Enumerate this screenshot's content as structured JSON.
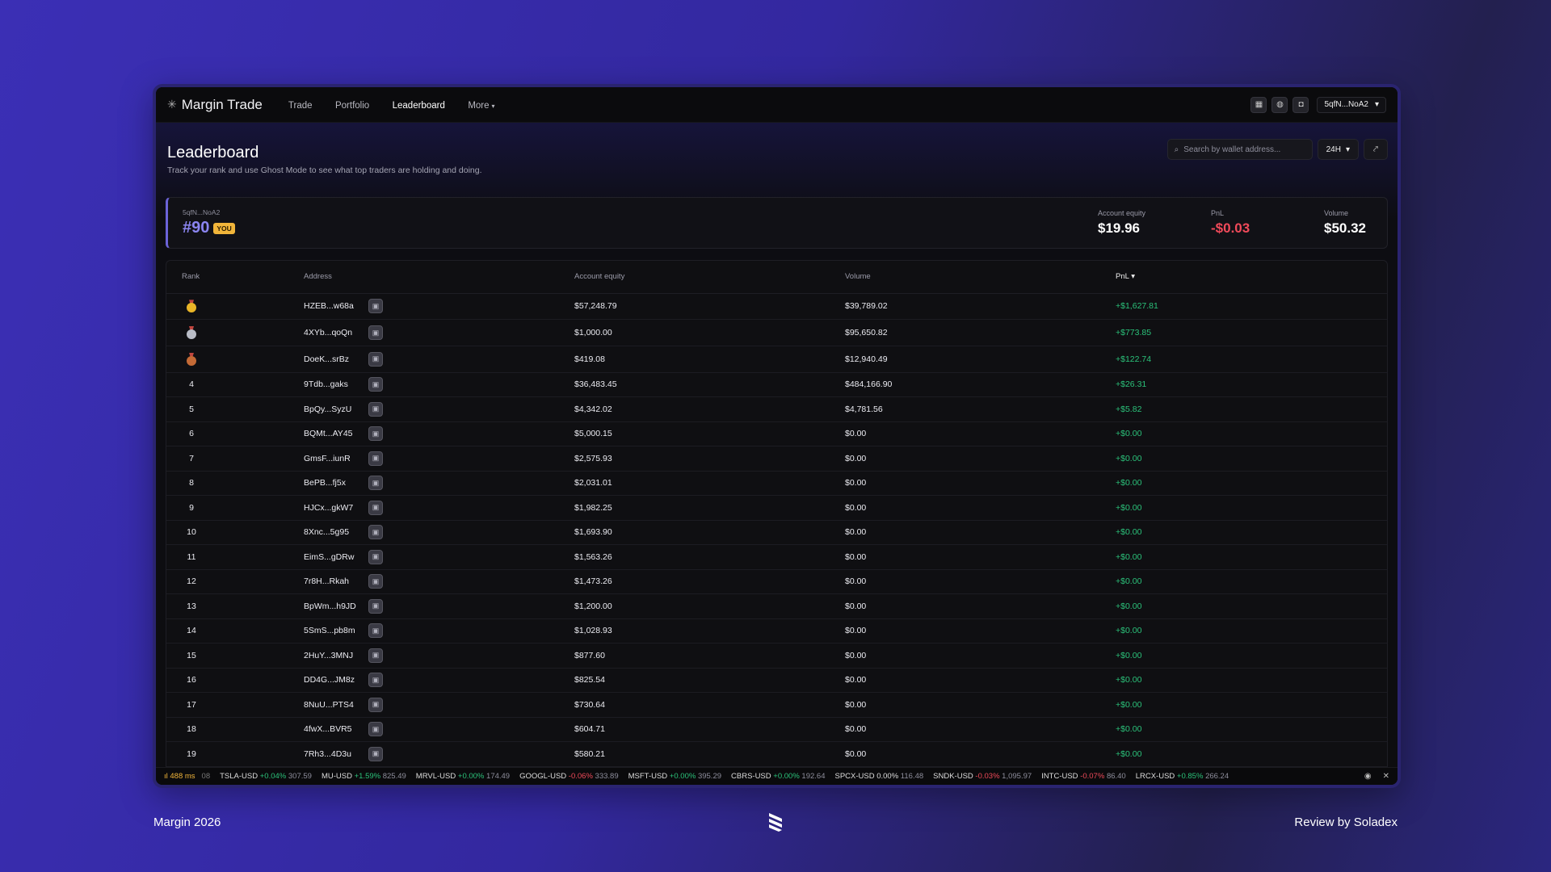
{
  "app": {
    "brand": "Margin Trade",
    "nav": [
      {
        "label": "Trade",
        "active": false
      },
      {
        "label": "Portfolio",
        "active": false
      },
      {
        "label": "Leaderboard",
        "active": true
      },
      {
        "label": "More",
        "active": false
      }
    ],
    "wallet": "5qfN...NoA2"
  },
  "page": {
    "title": "Leaderboard",
    "subtitle": "Track your rank and use Ghost Mode to see what top traders are holding and doing.",
    "search_placeholder": "Search by wallet address...",
    "period": "24H"
  },
  "you": {
    "address": "5qfN...NoA2",
    "rank": "#90",
    "badge": "YOU",
    "equity_label": "Account equity",
    "equity": "$19.96",
    "pnl_label": "PnL",
    "pnl": "-$0.03",
    "volume_label": "Volume",
    "volume": "$50.32"
  },
  "table": {
    "headers": {
      "rank": "Rank",
      "address": "Address",
      "equity": "Account equity",
      "volume": "Volume",
      "pnl": "PnL"
    },
    "rows": [
      {
        "rank": "1",
        "medal": "gold",
        "address": "HZEB...w68a",
        "equity": "$57,248.79",
        "volume": "$39,789.02",
        "pnl": "+$1,627.81"
      },
      {
        "rank": "2",
        "medal": "silver",
        "address": "4XYb...qoQn",
        "equity": "$1,000.00",
        "volume": "$95,650.82",
        "pnl": "+$773.85"
      },
      {
        "rank": "3",
        "medal": "bronze",
        "address": "DoeK...srBz",
        "equity": "$419.08",
        "volume": "$12,940.49",
        "pnl": "+$122.74"
      },
      {
        "rank": "4",
        "medal": "",
        "address": "9Tdb...gaks",
        "equity": "$36,483.45",
        "volume": "$484,166.90",
        "pnl": "+$26.31"
      },
      {
        "rank": "5",
        "medal": "",
        "address": "BpQy...SyzU",
        "equity": "$4,342.02",
        "volume": "$4,781.56",
        "pnl": "+$5.82"
      },
      {
        "rank": "6",
        "medal": "",
        "address": "BQMt...AY45",
        "equity": "$5,000.15",
        "volume": "$0.00",
        "pnl": "+$0.00"
      },
      {
        "rank": "7",
        "medal": "",
        "address": "GmsF...iunR",
        "equity": "$2,575.93",
        "volume": "$0.00",
        "pnl": "+$0.00"
      },
      {
        "rank": "8",
        "medal": "",
        "address": "BePB...fj5x",
        "equity": "$2,031.01",
        "volume": "$0.00",
        "pnl": "+$0.00"
      },
      {
        "rank": "9",
        "medal": "",
        "address": "HJCx...gkW7",
        "equity": "$1,982.25",
        "volume": "$0.00",
        "pnl": "+$0.00"
      },
      {
        "rank": "10",
        "medal": "",
        "address": "8Xnc...5g95",
        "equity": "$1,693.90",
        "volume": "$0.00",
        "pnl": "+$0.00"
      },
      {
        "rank": "11",
        "medal": "",
        "address": "EimS...gDRw",
        "equity": "$1,563.26",
        "volume": "$0.00",
        "pnl": "+$0.00"
      },
      {
        "rank": "12",
        "medal": "",
        "address": "7r8H...Rkah",
        "equity": "$1,473.26",
        "volume": "$0.00",
        "pnl": "+$0.00"
      },
      {
        "rank": "13",
        "medal": "",
        "address": "BpWm...h9JD",
        "equity": "$1,200.00",
        "volume": "$0.00",
        "pnl": "+$0.00"
      },
      {
        "rank": "14",
        "medal": "",
        "address": "5SmS...pb8m",
        "equity": "$1,028.93",
        "volume": "$0.00",
        "pnl": "+$0.00"
      },
      {
        "rank": "15",
        "medal": "",
        "address": "2HuY...3MNJ",
        "equity": "$877.60",
        "volume": "$0.00",
        "pnl": "+$0.00"
      },
      {
        "rank": "16",
        "medal": "",
        "address": "DD4G...JM8z",
        "equity": "$825.54",
        "volume": "$0.00",
        "pnl": "+$0.00"
      },
      {
        "rank": "17",
        "medal": "",
        "address": "8NuU...PTS4",
        "equity": "$730.64",
        "volume": "$0.00",
        "pnl": "+$0.00"
      },
      {
        "rank": "18",
        "medal": "",
        "address": "4fwX...BVR5",
        "equity": "$604.71",
        "volume": "$0.00",
        "pnl": "+$0.00"
      },
      {
        "rank": "19",
        "medal": "",
        "address": "7Rh3...4D3u",
        "equity": "$580.21",
        "volume": "$0.00",
        "pnl": "+$0.00"
      }
    ]
  },
  "ticker": {
    "latency": "488 ms",
    "block": "08",
    "items": [
      {
        "sym": "TSLA-USD",
        "chg": "+0.04%",
        "px": "307.59",
        "dir": "up"
      },
      {
        "sym": "MU-USD",
        "chg": "+1.59%",
        "px": "825.49",
        "dir": "up"
      },
      {
        "sym": "MRVL-USD",
        "chg": "+0.00%",
        "px": "174.49",
        "dir": "up"
      },
      {
        "sym": "GOOGL-USD",
        "chg": "-0.06%",
        "px": "333.89",
        "dir": "down"
      },
      {
        "sym": "MSFT-USD",
        "chg": "+0.00%",
        "px": "395.29",
        "dir": "up"
      },
      {
        "sym": "CBRS-USD",
        "chg": "+0.00%",
        "px": "192.64",
        "dir": "up"
      },
      {
        "sym": "SPCX-USD",
        "chg": "0.00%",
        "px": "116.48",
        "dir": "flat"
      },
      {
        "sym": "SNDK-USD",
        "chg": "-0.03%",
        "px": "1,095.97",
        "dir": "down"
      },
      {
        "sym": "INTC-USD",
        "chg": "-0.07%",
        "px": "86.40",
        "dir": "down"
      },
      {
        "sym": "LRCX-USD",
        "chg": "+0.85%",
        "px": "266.24",
        "dir": "up"
      }
    ]
  },
  "footer": {
    "left": "Margin 2026",
    "right": "Review by Soladex"
  },
  "colors": {
    "accent": "#8b85f0",
    "positive": "#2bc27a",
    "negative": "#f04a5a",
    "badge": "#f1b53a"
  }
}
